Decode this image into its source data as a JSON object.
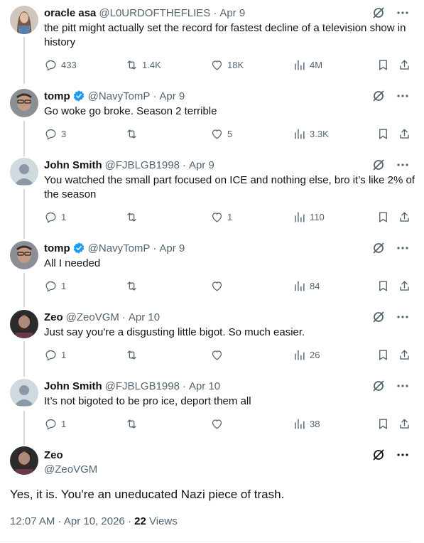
{
  "colors": {
    "text": "#0f1419",
    "secondary": "#536471",
    "verified": "#1d9bf0",
    "line": "#cfd9de"
  },
  "replies": [
    {
      "name": "oracle asa",
      "handle": "@L0URDOFTHEFLIES",
      "date": "Apr 9",
      "verified": false,
      "text": "the pitt might actually set the record for fastest decline of a television show in history",
      "replies": "433",
      "reposts": "1.4K",
      "likes": "18K",
      "views": "4M",
      "avatar": "avatar-woman-icon"
    },
    {
      "name": "tomp",
      "handle": "@NavyTomP",
      "date": "Apr 9",
      "verified": true,
      "text": "Go woke go broke. Season 2 terrible",
      "replies": "3",
      "reposts": "",
      "likes": "5",
      "views": "3.3K",
      "avatar": "avatar-man-icon"
    },
    {
      "name": "John Smith",
      "handle": "@FJBLGB1998",
      "date": "Apr 9",
      "verified": false,
      "text": "You watched the small part focused on ICE and nothing else, bro it’s like 2% of the season",
      "replies": "1",
      "reposts": "",
      "likes": "1",
      "views": "110",
      "avatar": "default-avatar-icon"
    },
    {
      "name": "tomp",
      "handle": "@NavyTomP",
      "date": "Apr 9",
      "verified": true,
      "text": "All I needed",
      "replies": "1",
      "reposts": "",
      "likes": "",
      "views": "84",
      "avatar": "avatar-man-icon"
    },
    {
      "name": "Zeo",
      "handle": "@ZeoVGM",
      "date": "Apr 10",
      "verified": false,
      "text": "Just say you're a disgusting little bigot. So much easier.",
      "replies": "1",
      "reposts": "",
      "likes": "",
      "views": "26",
      "avatar": "avatar-bearded-man-icon"
    },
    {
      "name": "John Smith",
      "handle": "@FJBLGB1998",
      "date": "Apr 10",
      "verified": false,
      "text": "It’s not bigoted to be pro ice, deport them all",
      "replies": "1",
      "reposts": "",
      "likes": "",
      "views": "38",
      "avatar": "default-avatar-icon"
    }
  ],
  "main": {
    "name": "Zeo",
    "handle": "@ZeoVGM",
    "text": "Yes, it is. You're an uneducated Nazi piece of trash.",
    "time": "12:07 AM · Apr 10, 2026 ·",
    "views_count": "22",
    "views_label": "Views",
    "avatar": "avatar-bearded-man-icon"
  }
}
